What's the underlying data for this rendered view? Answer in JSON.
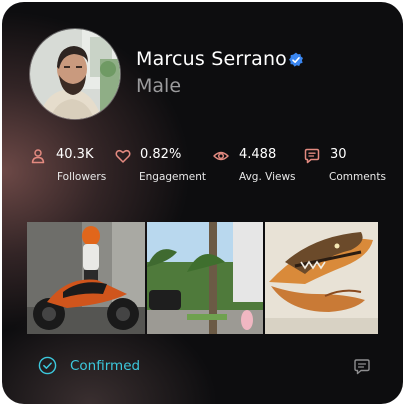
{
  "profile": {
    "name": "Marcus Serrano",
    "gender": "Male",
    "verified_icon": "verified-badge-icon",
    "avatar": "profile-photo"
  },
  "stats": [
    {
      "icon": "person-icon",
      "value": "40.3K",
      "label": "Followers"
    },
    {
      "icon": "heart-icon",
      "value": "0.82%",
      "label": "Engagement"
    },
    {
      "icon": "eye-icon",
      "value": "4.488",
      "label": "Avg. Views"
    },
    {
      "icon": "comment-icon",
      "value": "30",
      "label": "Comments"
    }
  ],
  "gallery": [
    {
      "subject": "motorcycle-photo"
    },
    {
      "subject": "palm-street-photo"
    },
    {
      "subject": "crocodile-mural-photo"
    }
  ],
  "footer": {
    "status_label": "Confirmed",
    "status_icon": "check-circle-icon",
    "action_icon": "chat-icon"
  },
  "colors": {
    "accent": "#3cc8dd",
    "stat_icon": "#e38a80",
    "verified": "#3a86f0",
    "background": "#0d0d0f",
    "secondary_text": "#9b9b9d"
  }
}
